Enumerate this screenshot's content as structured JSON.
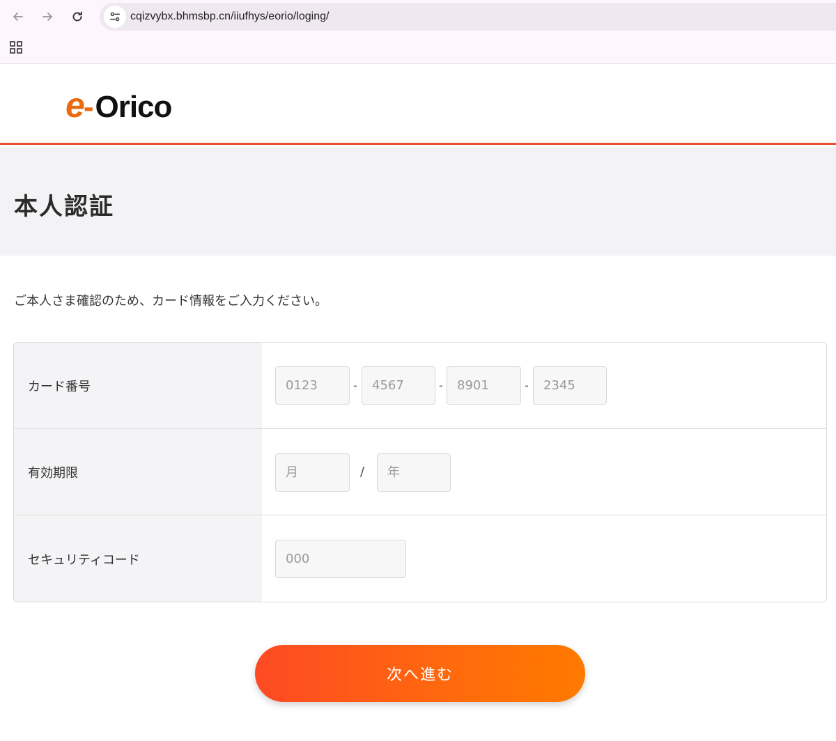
{
  "browser": {
    "url": "cqizvybx.bhmsbp.cn/iiufhys/eorio/loging/"
  },
  "header": {
    "logo_e": "e",
    "logo_dash": "-",
    "logo_name": "Orico"
  },
  "page": {
    "title": "本人認証",
    "intro": "ご本人さま確認のため、カード情報をご入力ください。"
  },
  "form": {
    "card_number": {
      "label": "カード番号",
      "placeholders": [
        "0123",
        "4567",
        "8901",
        "2345"
      ],
      "separator": "-"
    },
    "expiry": {
      "label": "有効期限",
      "month_placeholder": "月",
      "year_placeholder": "年",
      "separator": "/"
    },
    "security_code": {
      "label": "セキュリティコード",
      "placeholder": "000"
    }
  },
  "actions": {
    "next_label": "次へ進む"
  },
  "colors": {
    "accent": "#e8502a",
    "logo_orange": "#ea6a12",
    "button_start": "#fe4a24",
    "button_end": "#ff7a00"
  }
}
